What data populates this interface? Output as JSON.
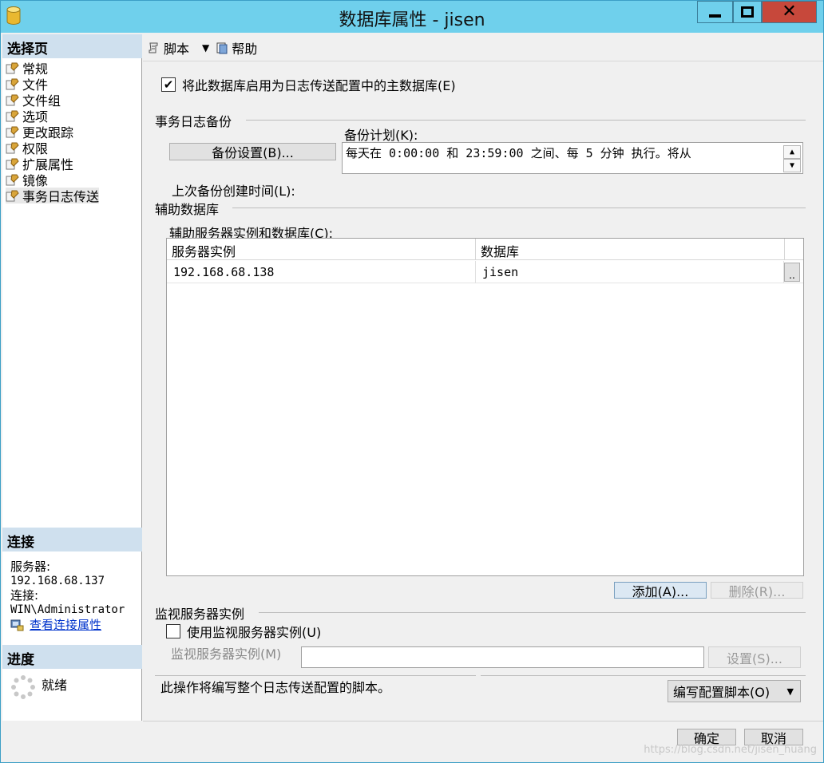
{
  "window": {
    "title": "数据库属性 - jisen"
  },
  "left": {
    "select_page_header": "选择页",
    "nav_items": [
      {
        "label": "常规"
      },
      {
        "label": "文件"
      },
      {
        "label": "文件组"
      },
      {
        "label": "选项"
      },
      {
        "label": "更改跟踪"
      },
      {
        "label": "权限"
      },
      {
        "label": "扩展属性"
      },
      {
        "label": "镜像"
      },
      {
        "label": "事务日志传送"
      }
    ],
    "connection_header": "连接",
    "server_label": "服务器:",
    "server_value": "192.168.68.137",
    "connection_label": "连接:",
    "connection_value": "WIN\\Administrator",
    "view_conn_props": "查看连接属性",
    "progress_header": "进度",
    "progress_status": "就绪"
  },
  "toolbar": {
    "script_label": "脚本",
    "help_label": "帮助"
  },
  "main": {
    "enable_primary_label": "将此数据库启用为日志传送配置中的主数据库(E)",
    "enable_primary_checked": true,
    "tlog_backup_group": "事务日志备份",
    "backup_settings_button": "备份设置(B)...",
    "backup_schedule_label": "备份计划(K):",
    "backup_schedule_text": "每天在 0:00:00 和 23:59:00 之间、每 5 分钟 执行。将从",
    "last_backup_label": "上次备份创建时间(L):",
    "secondary_group": "辅助数据库",
    "secondary_list_label": "辅助服务器实例和数据库(C):",
    "grid": {
      "columns": [
        "服务器实例",
        "数据库"
      ],
      "rows": [
        {
          "server": "192.168.68.138",
          "database": "jisen",
          "button": ".."
        }
      ]
    },
    "add_button": "添加(A)...",
    "remove_button": "删除(R)...",
    "monitor_group": "监视服务器实例",
    "use_monitor_label": "使用监视服务器实例(U)",
    "use_monitor_checked": false,
    "monitor_instance_label": "监视服务器实例(M)",
    "monitor_instance_value": "",
    "monitor_settings_button": "设置(S)...",
    "script_note": "此操作将编写整个日志传送配置的脚本。",
    "script_config_button": "编写配置脚本(O)"
  },
  "footer": {
    "ok_button": "确定",
    "cancel_button": "取消",
    "watermark": "https://blog.csdn.net/jisen_huang"
  },
  "colors": {
    "titlebar": "#6fd0ec",
    "close_button": "#c7483b",
    "section_header": "#cfe0ee",
    "link": "#0033cc"
  }
}
